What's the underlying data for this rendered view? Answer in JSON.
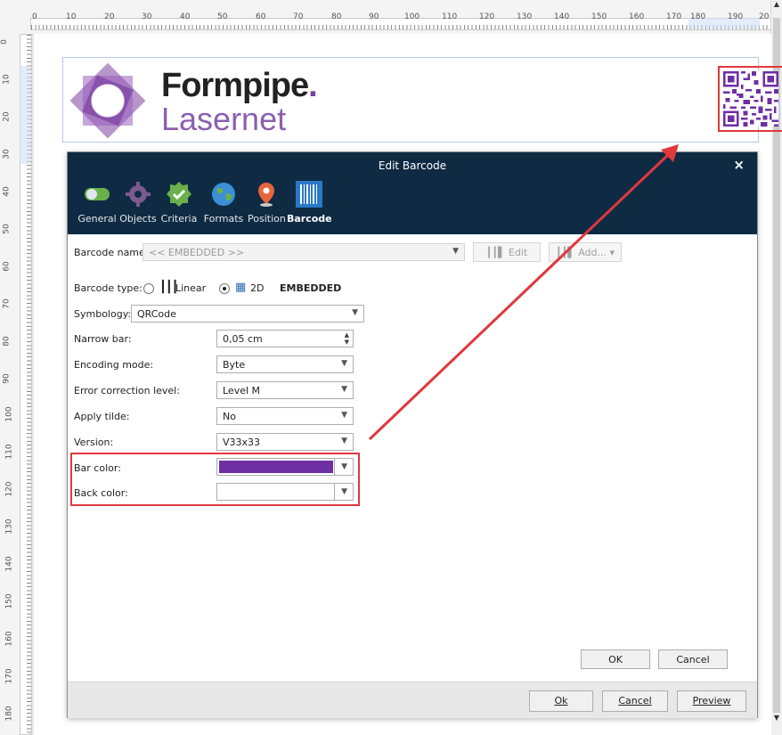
{
  "ruler": {
    "top_ticks": [
      "0",
      "10",
      "20",
      "30",
      "40",
      "50",
      "60",
      "70",
      "80",
      "90",
      "100",
      "110",
      "120",
      "130",
      "140",
      "150",
      "160",
      "170",
      "180",
      "190",
      "20"
    ],
    "left_ticks": [
      "0",
      "10",
      "20",
      "30",
      "40",
      "50",
      "60",
      "70",
      "80",
      "90",
      "100",
      "110",
      "120",
      "130",
      "140",
      "150",
      "160",
      "170",
      "180"
    ]
  },
  "logo": {
    "word1": "Formpipe",
    "dot": ".",
    "word2": "Lasernet"
  },
  "dialog": {
    "title": "Edit Barcode",
    "close": "×",
    "tabs": [
      "General",
      "Objects",
      "Criteria",
      "Formats",
      "Position",
      "Barcode"
    ],
    "active_tab": "Barcode",
    "barcode_name_label": "Barcode name",
    "barcode_name_value": "<< EMBEDDED >>",
    "edit_button": "Edit",
    "add_button": "Add...",
    "barcode_type_label": "Barcode type:",
    "type_linear": "Linear",
    "type_2d": "2D",
    "type_embedded": "EMBEDDED",
    "symbology_label": "Symbology:",
    "symbology_value": "QRCode",
    "fields": [
      {
        "label": "Narrow bar:",
        "value": "0,05 cm"
      },
      {
        "label": "Encoding mode:",
        "value": "Byte"
      },
      {
        "label": "Error correction level:",
        "value": "Level M"
      },
      {
        "label": "Apply tilde:",
        "value": "No"
      },
      {
        "label": "Version:",
        "value": "V33x33"
      }
    ],
    "bar_color_label": "Bar color:",
    "back_color_label": "Back color:",
    "ok_inner": "OK",
    "cancel_inner": "Cancel",
    "footer_ok": "Ok",
    "footer_cancel": "Cancel",
    "footer_preview": "Preview"
  },
  "colors": {
    "title_bar": "#0f2b44",
    "bar_color": "#6e2fa3",
    "highlight": "#e0383d"
  }
}
